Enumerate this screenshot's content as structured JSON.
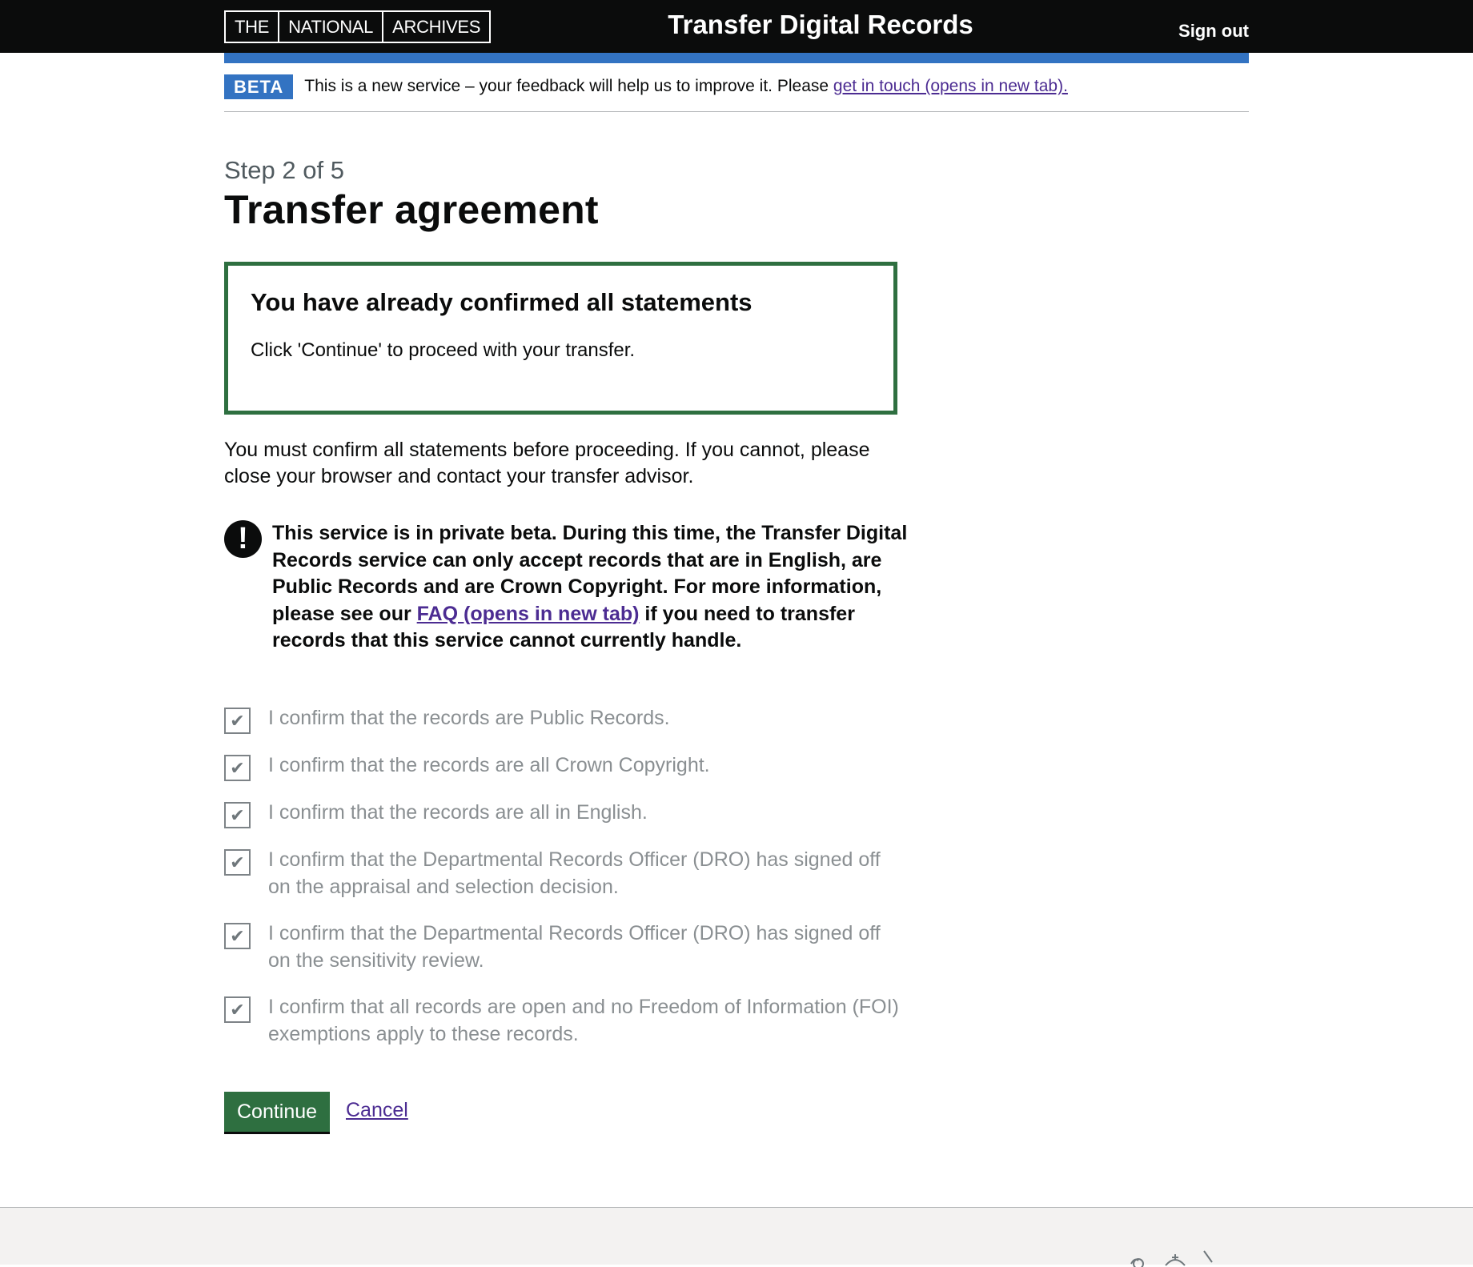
{
  "header": {
    "logo_parts": [
      "THE",
      "NATIONAL",
      "ARCHIVES"
    ],
    "service_name": "Transfer Digital Records",
    "sign_out": "Sign out"
  },
  "phase_banner": {
    "tag": "BETA",
    "text": "This is a new service – your feedback will help us to improve it. Please ",
    "link": "get in touch (opens in new tab)."
  },
  "page": {
    "caption": "Step 2 of 5",
    "title": "Transfer agreement"
  },
  "success_panel": {
    "title": "You have already confirmed all statements",
    "body": "Click 'Continue' to proceed with your transfer."
  },
  "intro": "You must confirm all statements before proceeding. If you cannot, please close your browser and contact your transfer advisor.",
  "warning": {
    "icon": "!",
    "text_before": "This service is in private beta. During this time, the Transfer Digital Records service can only accept records that are in English, are Public Records and are Crown Copyright. For more information, please see our ",
    "link": "FAQ (opens in new tab)",
    "text_after": " if you need to transfer records that this service cannot currently handle."
  },
  "statements": [
    {
      "label": "I confirm that the records are Public Records.",
      "checked": true
    },
    {
      "label": "I confirm that the records are all Crown Copyright.",
      "checked": true
    },
    {
      "label": "I confirm that the records are all in English.",
      "checked": true
    },
    {
      "label": "I confirm that the Departmental Records Officer (DRO) has signed off on the appraisal and selection decision.",
      "checked": true
    },
    {
      "label": "I confirm that the Departmental Records Officer (DRO) has signed off on the sensitivity review.",
      "checked": true
    },
    {
      "label": "I confirm that all records are open and no Freedom of Information (FOI) exemptions apply to these records.",
      "checked": true
    }
  ],
  "actions": {
    "continue": "Continue",
    "cancel": "Cancel"
  },
  "colors": {
    "header_bg": "#0b0c0c",
    "accent_blue": "#3373c2",
    "success_green": "#2e6f40",
    "link_purple": "#4c2c92"
  }
}
